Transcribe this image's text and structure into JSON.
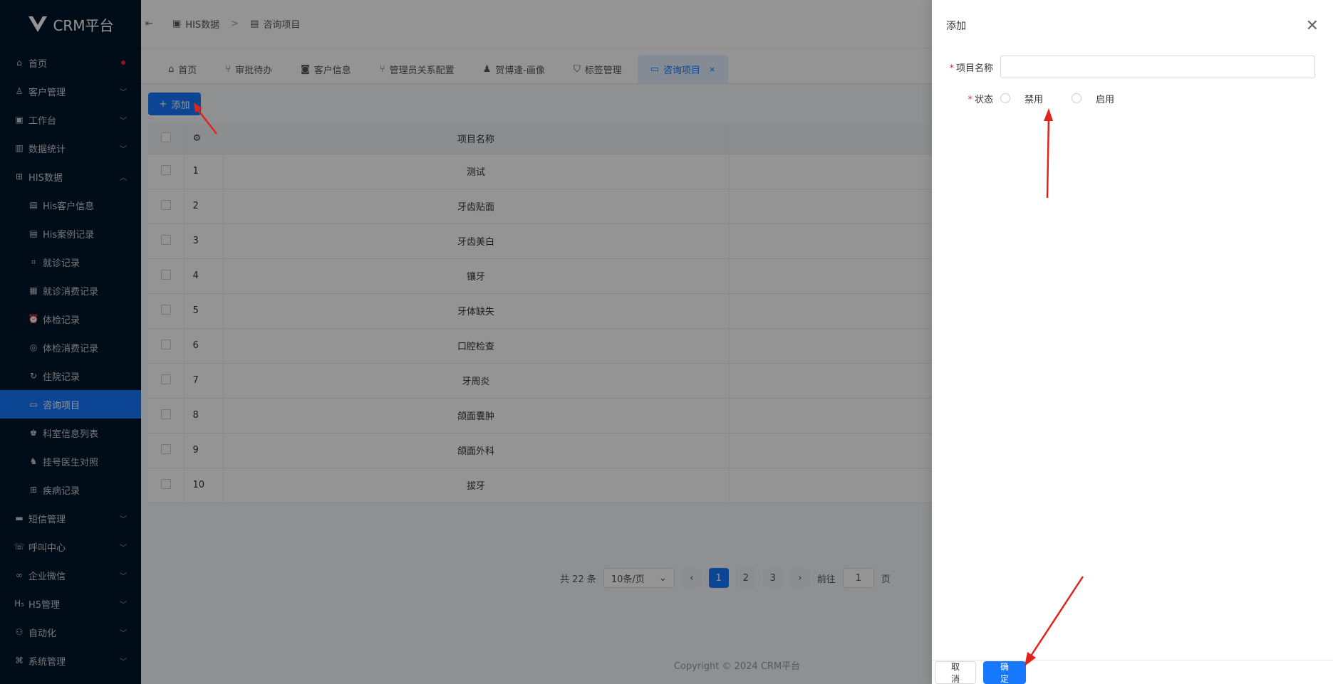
{
  "app": {
    "logo_text": "CRM平台"
  },
  "sidebar": {
    "items": [
      {
        "label": "首页",
        "icon": "home-icon",
        "badge": "dot"
      },
      {
        "label": "客户管理",
        "icon": "user-icon",
        "chevron": "down"
      },
      {
        "label": "工作台",
        "icon": "briefcase-icon",
        "chevron": "down"
      },
      {
        "label": "数据统计",
        "icon": "bar-chart-icon",
        "chevron": "down"
      },
      {
        "label": "HIS数据",
        "icon": "medical-bag-icon",
        "chevron": "up"
      },
      {
        "label": "His客户信息",
        "icon": "doc-icon",
        "sub": true
      },
      {
        "label": "His案例记录",
        "icon": "doc-icon",
        "sub": true
      },
      {
        "label": "就诊记录",
        "icon": "scan-icon",
        "sub": true
      },
      {
        "label": "就诊消费记录",
        "icon": "wallet-icon",
        "sub": true
      },
      {
        "label": "体检记录",
        "icon": "alarm-icon",
        "sub": true
      },
      {
        "label": "体检消费记录",
        "icon": "circle-icon",
        "sub": true
      },
      {
        "label": "住院记录",
        "icon": "refresh-icon",
        "sub": true
      },
      {
        "label": "咨询项目",
        "icon": "archive-icon",
        "sub": true,
        "active": true
      },
      {
        "label": "科室信息列表",
        "icon": "users-icon",
        "sub": true
      },
      {
        "label": "挂号医生对照",
        "icon": "user-list-icon",
        "sub": true
      },
      {
        "label": "疾病记录",
        "icon": "medical-bag-icon",
        "sub": true
      },
      {
        "label": "短信管理",
        "icon": "message-icon",
        "chevron": "down"
      },
      {
        "label": "呼叫中心",
        "icon": "phone-icon",
        "chevron": "down"
      },
      {
        "label": "企业微信",
        "icon": "link-icon",
        "chevron": "down"
      },
      {
        "label": "H5管理",
        "icon": "h5-icon",
        "chevron": "down"
      },
      {
        "label": "自动化",
        "icon": "flow-icon",
        "chevron": "down"
      },
      {
        "label": "系统管理",
        "icon": "command-icon",
        "chevron": "down"
      }
    ]
  },
  "breadcrumb": {
    "parent": "HIS数据",
    "separator": ">",
    "current": "咨询项目"
  },
  "tabs": [
    {
      "label": "首页",
      "icon": "home-icon"
    },
    {
      "label": "审批待办",
      "icon": "branch-icon"
    },
    {
      "label": "客户信息",
      "icon": "id-icon"
    },
    {
      "label": "管理员关系配置",
      "icon": "branch-icon"
    },
    {
      "label": "贺博逢-画像",
      "icon": "person-icon"
    },
    {
      "label": "标签管理",
      "icon": "shield-icon"
    },
    {
      "label": "咨询项目",
      "icon": "archive-icon",
      "active": true,
      "close": "×"
    }
  ],
  "toolbar": {
    "add_label": "添加",
    "add_icon": "+"
  },
  "table": {
    "header_name": "项目名称",
    "rows": [
      {
        "idx": "1",
        "name": "测试"
      },
      {
        "idx": "2",
        "name": "牙齿贴面"
      },
      {
        "idx": "3",
        "name": "牙齿美白"
      },
      {
        "idx": "4",
        "name": "镶牙"
      },
      {
        "idx": "5",
        "name": "牙体缺失"
      },
      {
        "idx": "6",
        "name": "口腔检查"
      },
      {
        "idx": "7",
        "name": "牙周炎"
      },
      {
        "idx": "8",
        "name": "颌面囊肿"
      },
      {
        "idx": "9",
        "name": "颌面外科"
      },
      {
        "idx": "10",
        "name": "拔牙"
      }
    ]
  },
  "pagination": {
    "total": "共 22 条",
    "page_size": "10条/页",
    "pages": [
      "1",
      "2",
      "3"
    ],
    "current": "1",
    "goto_prefix": "前往",
    "goto_value": "1",
    "goto_suffix": "页"
  },
  "footer": {
    "copyright": "Copyright © 2024 CRM平台"
  },
  "drawer": {
    "title": "添加",
    "fields": {
      "name_label": "项目名称",
      "name_value": "",
      "status_label": "状态",
      "status_options": [
        "禁用",
        "启用"
      ]
    },
    "cancel_label": "取 消",
    "ok_label": "确 定"
  },
  "colors": {
    "primary": "#1677ff",
    "sidebar_bg": "#001529",
    "annotation_arrow": "#e0231c"
  }
}
